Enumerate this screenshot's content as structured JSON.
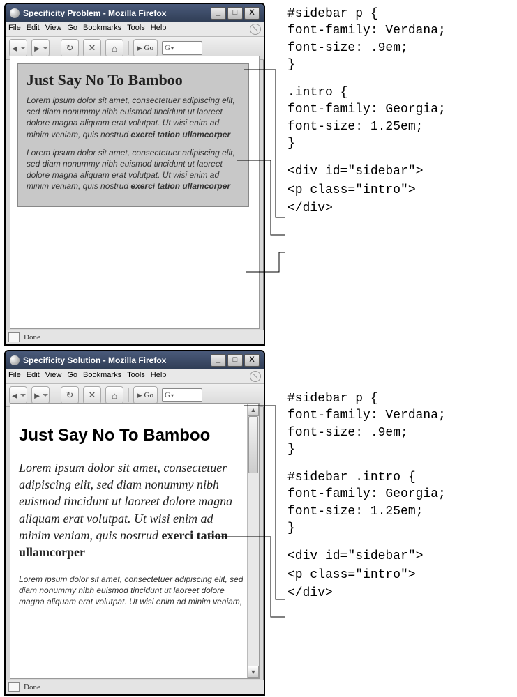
{
  "windows": {
    "problem": {
      "title": "Specificity Problem - Mozilla Firefox",
      "heading": "Just Say No To Bamboo",
      "para1_plain": "Lorem ipsum dolor sit amet, consectetuer adipiscing elit, sed diam nonummy nibh euismod tincidunt ut laoreet dolore magna aliquam erat volutpat. Ut wisi enim ad minim veniam, quis nostrud ",
      "para1_bold": "exerci tation ullamcorper",
      "para2_plain": "Lorem ipsum dolor sit amet, consectetuer adipiscing elit, sed diam nonummy nibh euismod tincidunt ut laoreet dolore magna aliquam erat volutpat. Ut wisi enim ad minim veniam, quis nostrud ",
      "para2_bold": "exerci tation ullamcorper"
    },
    "solution": {
      "title": "Specificity Solution - Mozilla Firefox",
      "heading": "Just Say No To Bamboo",
      "para1_plain": "Lorem ipsum dolor sit amet, consectetuer adipiscing elit, sed diam nonummy nibh euismod tincidunt ut laoreet dolore magna aliquam erat volutpat. Ut wisi enim ad minim veniam, quis nostrud ",
      "para1_bold": "exerci tation ullamcorper",
      "para2_plain": "Lorem ipsum dolor sit amet, consectetuer adipiscing elit, sed diam nonummy nibh euismod tincidunt ut laoreet dolore magna aliquam erat volutpat. Ut wisi enim ad minim veniam,"
    }
  },
  "menus": {
    "file": "File",
    "edit": "Edit",
    "view": "View",
    "go": "Go",
    "bookmarks": "Bookmarks",
    "tools": "Tools",
    "help": "Help"
  },
  "toolbar": {
    "go": "Go",
    "search_hint": "G"
  },
  "status": {
    "text": "Done"
  },
  "win_controls": {
    "min": "_",
    "max": "□",
    "close": "X"
  },
  "code": {
    "problem": {
      "rule1": "#sidebar p {\nfont-family: Verdana;\nfont-size: .9em;\n}",
      "rule2": ".intro {\nfont-family: Georgia;\nfont-size: 1.25em;\n}",
      "html1": "<div id=\"sidebar\">",
      "html2": "<p class=\"intro\">",
      "html3": "</div>"
    },
    "solution": {
      "rule1": "#sidebar p {\nfont-family: Verdana;\nfont-size: .9em;\n}",
      "rule2": "#sidebar .intro {\nfont-family: Georgia;\nfont-size: 1.25em;\n}",
      "html1": "<div id=\"sidebar\">",
      "html2": "<p class=\"intro\">",
      "html3": "</div>"
    }
  }
}
